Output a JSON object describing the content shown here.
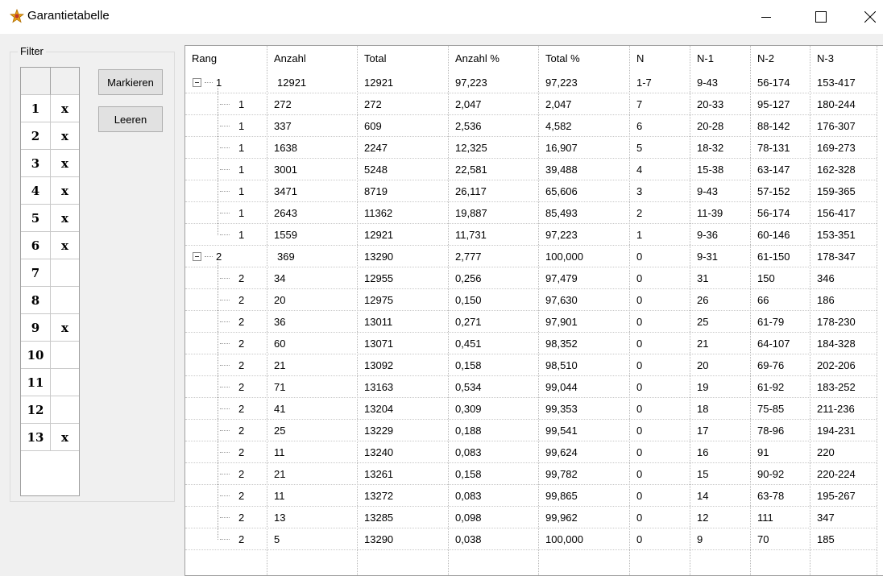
{
  "window": {
    "title": "Garantietabelle",
    "icon": "puzzle-star-icon"
  },
  "filter": {
    "legend": "Filter",
    "rows": [
      {
        "num": "1",
        "mark": "x"
      },
      {
        "num": "2",
        "mark": "x"
      },
      {
        "num": "3",
        "mark": "x"
      },
      {
        "num": "4",
        "mark": "x"
      },
      {
        "num": "5",
        "mark": "x"
      },
      {
        "num": "6",
        "mark": "x"
      },
      {
        "num": "7",
        "mark": ""
      },
      {
        "num": "8",
        "mark": ""
      },
      {
        "num": "9",
        "mark": "x"
      },
      {
        "num": "10",
        "mark": ""
      },
      {
        "num": "11",
        "mark": ""
      },
      {
        "num": "12",
        "mark": ""
      },
      {
        "num": "13",
        "mark": "x"
      }
    ]
  },
  "buttons": {
    "markieren": "Markieren",
    "leeren": "Leeren"
  },
  "table": {
    "columns": [
      "Rang",
      "Anzahl",
      "Total",
      "Anzahl %",
      "Total %",
      "N",
      "N-1",
      "N-2",
      "N-3"
    ],
    "rows": [
      {
        "level": 0,
        "rang": "1",
        "anzahl": "12921",
        "total": "12921",
        "anzahl_pct": "97,223",
        "total_pct": "97,223",
        "n": "1-7",
        "n1": "9-43",
        "n2": "56-174",
        "n3": "153-417"
      },
      {
        "level": 1,
        "rang": "1",
        "anzahl": "272",
        "total": "272",
        "anzahl_pct": "2,047",
        "total_pct": "2,047",
        "n": "7",
        "n1": "20-33",
        "n2": "95-127",
        "n3": "180-244"
      },
      {
        "level": 1,
        "rang": "1",
        "anzahl": "337",
        "total": "609",
        "anzahl_pct": "2,536",
        "total_pct": "4,582",
        "n": "6",
        "n1": "20-28",
        "n2": "88-142",
        "n3": "176-307"
      },
      {
        "level": 1,
        "rang": "1",
        "anzahl": "1638",
        "total": "2247",
        "anzahl_pct": "12,325",
        "total_pct": "16,907",
        "n": "5",
        "n1": "18-32",
        "n2": "78-131",
        "n3": "169-273"
      },
      {
        "level": 1,
        "rang": "1",
        "anzahl": "3001",
        "total": "5248",
        "anzahl_pct": "22,581",
        "total_pct": "39,488",
        "n": "4",
        "n1": "15-38",
        "n2": "63-147",
        "n3": "162-328"
      },
      {
        "level": 1,
        "rang": "1",
        "anzahl": "3471",
        "total": "8719",
        "anzahl_pct": "26,117",
        "total_pct": "65,606",
        "n": "3",
        "n1": "9-43",
        "n2": "57-152",
        "n3": "159-365"
      },
      {
        "level": 1,
        "rang": "1",
        "anzahl": "2643",
        "total": "11362",
        "anzahl_pct": "19,887",
        "total_pct": "85,493",
        "n": "2",
        "n1": "11-39",
        "n2": "56-174",
        "n3": "156-417"
      },
      {
        "level": 1,
        "rang": "1",
        "anzahl": "1559",
        "total": "12921",
        "anzahl_pct": "11,731",
        "total_pct": "97,223",
        "n": "1",
        "n1": "9-36",
        "n2": "60-146",
        "n3": "153-351"
      },
      {
        "level": 0,
        "rang": "2",
        "anzahl": "369",
        "total": "13290",
        "anzahl_pct": "2,777",
        "total_pct": "100,000",
        "n": "0",
        "n1": "9-31",
        "n2": "61-150",
        "n3": "178-347"
      },
      {
        "level": 1,
        "rang": "2",
        "anzahl": "34",
        "total": "12955",
        "anzahl_pct": "0,256",
        "total_pct": "97,479",
        "n": "0",
        "n1": "31",
        "n2": "150",
        "n3": "346"
      },
      {
        "level": 1,
        "rang": "2",
        "anzahl": "20",
        "total": "12975",
        "anzahl_pct": "0,150",
        "total_pct": "97,630",
        "n": "0",
        "n1": "26",
        "n2": "66",
        "n3": "186"
      },
      {
        "level": 1,
        "rang": "2",
        "anzahl": "36",
        "total": "13011",
        "anzahl_pct": "0,271",
        "total_pct": "97,901",
        "n": "0",
        "n1": "25",
        "n2": "61-79",
        "n3": "178-230"
      },
      {
        "level": 1,
        "rang": "2",
        "anzahl": "60",
        "total": "13071",
        "anzahl_pct": "0,451",
        "total_pct": "98,352",
        "n": "0",
        "n1": "21",
        "n2": "64-107",
        "n3": "184-328"
      },
      {
        "level": 1,
        "rang": "2",
        "anzahl": "21",
        "total": "13092",
        "anzahl_pct": "0,158",
        "total_pct": "98,510",
        "n": "0",
        "n1": "20",
        "n2": "69-76",
        "n3": "202-206"
      },
      {
        "level": 1,
        "rang": "2",
        "anzahl": "71",
        "total": "13163",
        "anzahl_pct": "0,534",
        "total_pct": "99,044",
        "n": "0",
        "n1": "19",
        "n2": "61-92",
        "n3": "183-252"
      },
      {
        "level": 1,
        "rang": "2",
        "anzahl": "41",
        "total": "13204",
        "anzahl_pct": "0,309",
        "total_pct": "99,353",
        "n": "0",
        "n1": "18",
        "n2": "75-85",
        "n3": "211-236"
      },
      {
        "level": 1,
        "rang": "2",
        "anzahl": "25",
        "total": "13229",
        "anzahl_pct": "0,188",
        "total_pct": "99,541",
        "n": "0",
        "n1": "17",
        "n2": "78-96",
        "n3": "194-231"
      },
      {
        "level": 1,
        "rang": "2",
        "anzahl": "11",
        "total": "13240",
        "anzahl_pct": "0,083",
        "total_pct": "99,624",
        "n": "0",
        "n1": "16",
        "n2": "91",
        "n3": "220"
      },
      {
        "level": 1,
        "rang": "2",
        "anzahl": "21",
        "total": "13261",
        "anzahl_pct": "0,158",
        "total_pct": "99,782",
        "n": "0",
        "n1": "15",
        "n2": "90-92",
        "n3": "220-224"
      },
      {
        "level": 1,
        "rang": "2",
        "anzahl": "11",
        "total": "13272",
        "anzahl_pct": "0,083",
        "total_pct": "99,865",
        "n": "0",
        "n1": "14",
        "n2": "63-78",
        "n3": "195-267"
      },
      {
        "level": 1,
        "rang": "2",
        "anzahl": "13",
        "total": "13285",
        "anzahl_pct": "0,098",
        "total_pct": "99,962",
        "n": "0",
        "n1": "12",
        "n2": "111",
        "n3": "347"
      },
      {
        "level": 1,
        "rang": "2",
        "anzahl": "5",
        "total": "13290",
        "anzahl_pct": "0,038",
        "total_pct": "100,000",
        "n": "0",
        "n1": "9",
        "n2": "70",
        "n3": "185"
      }
    ]
  }
}
